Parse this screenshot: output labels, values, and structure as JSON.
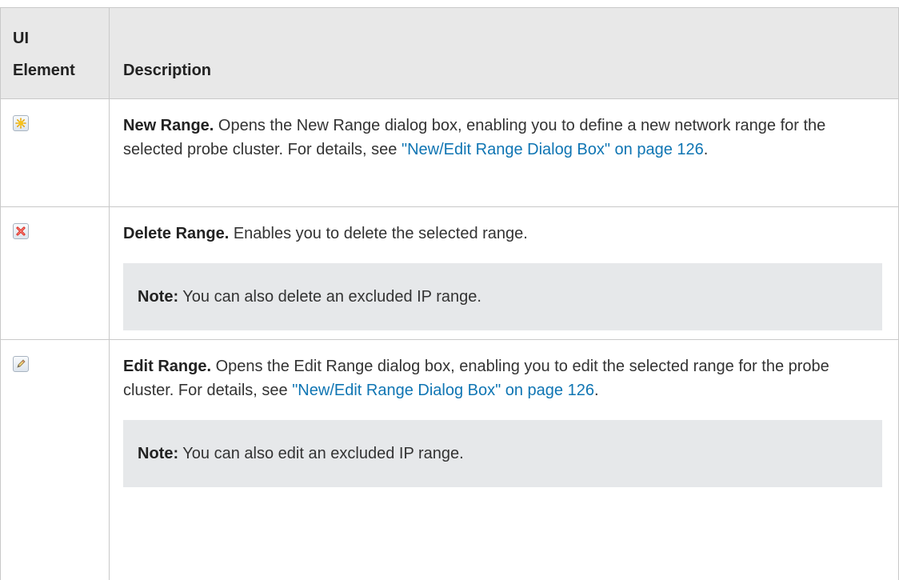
{
  "header": {
    "col1_line1": "UI",
    "col1_line2": "Element",
    "col2": "Description"
  },
  "rows": [
    {
      "icon": "new-range-icon",
      "title": "New Range.",
      "text": " Opens the New Range dialog box, enabling you to define a new network range for the selected probe cluster. For details, see ",
      "link": "\"New/Edit Range Dialog Box\" on page 126",
      "tail": "."
    },
    {
      "icon": "delete-range-icon",
      "title": "Delete Range.",
      "text": " Enables you to delete the selected range.",
      "note_label": "Note:",
      "note_text": " You can also delete an excluded IP range."
    },
    {
      "icon": "edit-range-icon",
      "title": "Edit Range.",
      "text": " Opens the Edit Range dialog box, enabling you to edit the selected range for the probe cluster. For details, see ",
      "link": "\"New/Edit Range Dialog Box\" on page 126",
      "tail": ".",
      "note_label": "Note:",
      "note_text": " You can also edit an excluded IP range."
    }
  ]
}
